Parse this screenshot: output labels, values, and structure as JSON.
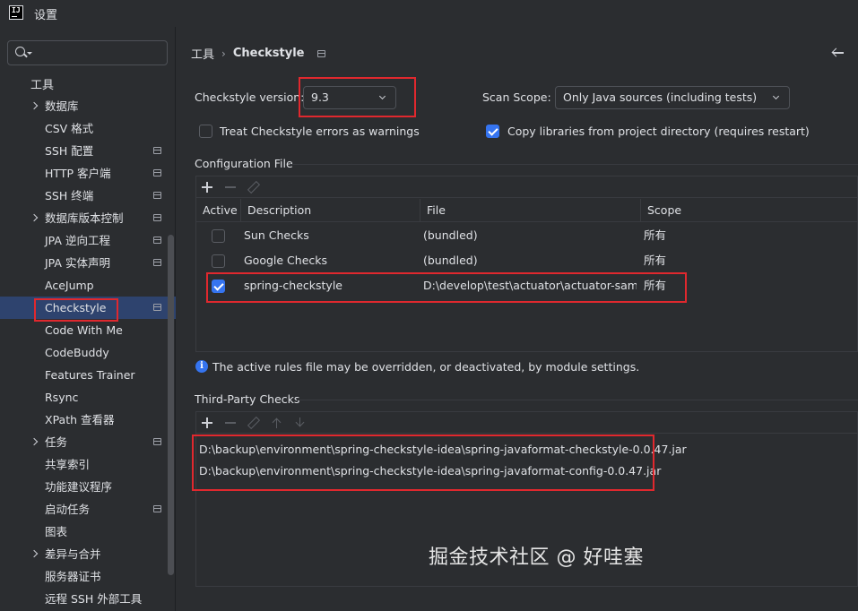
{
  "window": {
    "title": "设置"
  },
  "sidebar": {
    "search_placeholder": "",
    "header": "工具",
    "items": [
      {
        "label": "数据库",
        "chevron": true,
        "project": false
      },
      {
        "label": "CSV 格式",
        "chevron": false,
        "project": false
      },
      {
        "label": "SSH 配置",
        "chevron": false,
        "project": true
      },
      {
        "label": "HTTP 客户端",
        "chevron": false,
        "project": true
      },
      {
        "label": "SSH 终端",
        "chevron": false,
        "project": true
      },
      {
        "label": "数据库版本控制",
        "chevron": true,
        "project": true
      },
      {
        "label": "JPA 逆向工程",
        "chevron": false,
        "project": true
      },
      {
        "label": "JPA 实体声明",
        "chevron": false,
        "project": true
      },
      {
        "label": "AceJump",
        "chevron": false,
        "project": false
      },
      {
        "label": "Checkstyle",
        "chevron": false,
        "project": true,
        "selected": true
      },
      {
        "label": "Code With Me",
        "chevron": false,
        "project": false
      },
      {
        "label": "CodeBuddy",
        "chevron": false,
        "project": false
      },
      {
        "label": "Features Trainer",
        "chevron": false,
        "project": false
      },
      {
        "label": "Rsync",
        "chevron": false,
        "project": false
      },
      {
        "label": "XPath 查看器",
        "chevron": false,
        "project": false
      },
      {
        "label": "任务",
        "chevron": true,
        "project": true
      },
      {
        "label": "共享索引",
        "chevron": false,
        "project": false
      },
      {
        "label": "功能建议程序",
        "chevron": false,
        "project": false
      },
      {
        "label": "启动任务",
        "chevron": false,
        "project": true
      },
      {
        "label": "图表",
        "chevron": false,
        "project": false
      },
      {
        "label": "差异与合并",
        "chevron": true,
        "project": false
      },
      {
        "label": "服务器证书",
        "chevron": false,
        "project": false
      },
      {
        "label": "远程 SSH 外部工具",
        "chevron": false,
        "project": false
      }
    ]
  },
  "breadcrumb": {
    "parent": "工具",
    "separator": "›",
    "current": "Checkstyle"
  },
  "form": {
    "version_label": "Checkstyle version:",
    "version_value": "9.3",
    "scope_label": "Scan Scope:",
    "scope_value": "Only Java sources (including tests)",
    "treat_errors_label": "Treat Checkstyle errors as warnings",
    "treat_errors_checked": false,
    "copy_libs_label": "Copy libraries from project directory (requires restart)",
    "copy_libs_checked": true
  },
  "config_section": {
    "title": "Configuration File",
    "columns": [
      "Active",
      "Description",
      "File",
      "Scope"
    ],
    "rows": [
      {
        "active": false,
        "description": "Sun Checks",
        "file": "(bundled)",
        "scope": "所有"
      },
      {
        "active": false,
        "description": "Google Checks",
        "file": "(bundled)",
        "scope": "所有"
      },
      {
        "active": true,
        "description": "spring-checkstyle",
        "file": "D:\\develop\\test\\actuator\\actuator-sam...",
        "scope": "所有"
      }
    ],
    "info_text": "The active rules file may be overridden, or deactivated, by module settings."
  },
  "third_party": {
    "title": "Third-Party Checks",
    "jars": [
      "D:\\backup\\environment\\spring-checkstyle-idea\\spring-javaformat-checkstyle-0.0.47.jar",
      "D:\\backup\\environment\\spring-checkstyle-idea\\spring-javaformat-config-0.0.47.jar"
    ]
  },
  "watermark": "掘金技术社区 @ 好哇塞",
  "colors": {
    "accent": "#3574f0",
    "selection": "#2e436e",
    "highlight_box": "#e0282e"
  }
}
